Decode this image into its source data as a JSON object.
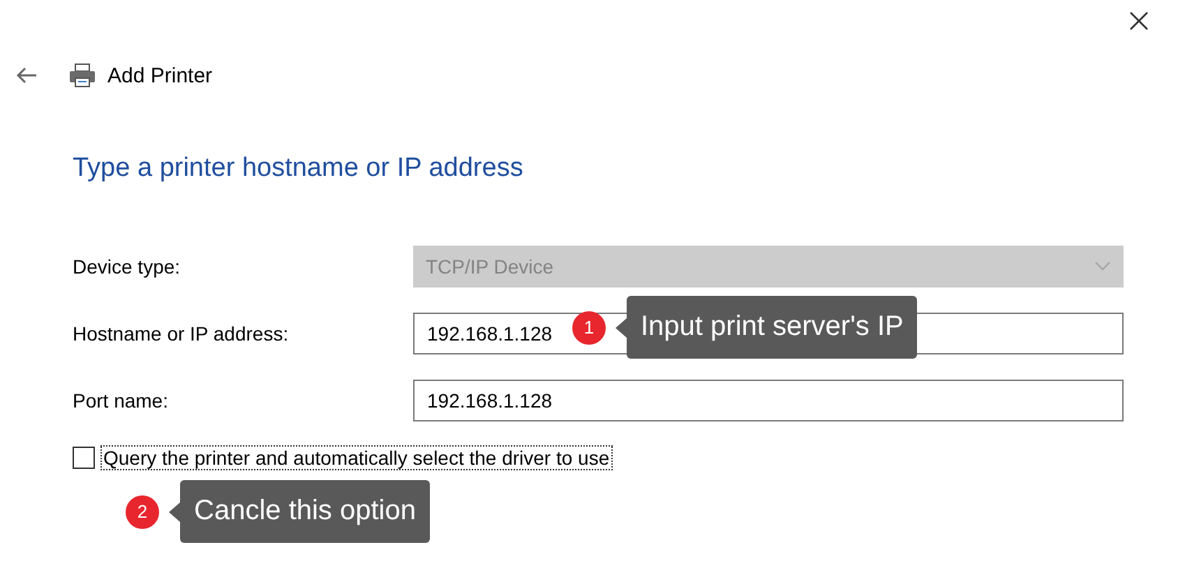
{
  "window": {
    "title": "Add Printer"
  },
  "heading": "Type a printer hostname or IP address",
  "fields": [
    {
      "kind": "dropdown",
      "label": "Device type:",
      "value": "TCP/IP Device",
      "disabled": true
    },
    {
      "kind": "text",
      "label": "Hostname or IP address:",
      "value": "192.168.1.128",
      "disabled": false,
      "callout": {
        "number": "1",
        "text": "Input print server's IP"
      }
    },
    {
      "kind": "text",
      "label": "Port name:",
      "value": "192.168.1.128",
      "disabled": false
    }
  ],
  "query_checkbox": {
    "label": "Query the printer and automatically select the driver to use",
    "checked": false,
    "focused": true,
    "callout": {
      "number": "2",
      "text": "Cancle this option"
    }
  }
}
